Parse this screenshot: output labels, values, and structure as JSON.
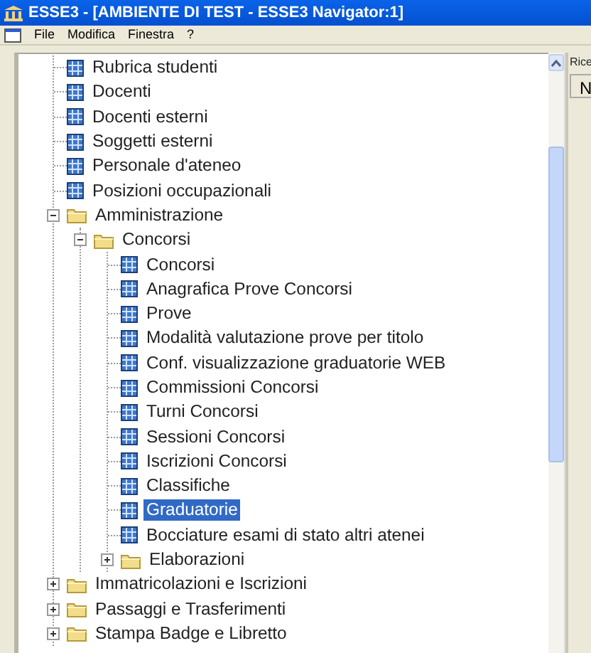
{
  "window": {
    "title": "ESSE3 - [AMBIENTE DI TEST - ESSE3  Navigator:1]"
  },
  "menu": [
    "File",
    "Modifica",
    "Finestra",
    "?"
  ],
  "tree": [
    {
      "kind": "leaf",
      "label": "Rubrica studenti",
      "selected": false
    },
    {
      "kind": "leaf",
      "label": "Docenti",
      "selected": false
    },
    {
      "kind": "leaf",
      "label": "Docenti esterni",
      "selected": false
    },
    {
      "kind": "leaf",
      "label": "Soggetti esterni",
      "selected": false
    },
    {
      "kind": "leaf",
      "label": "Personale d'ateneo",
      "selected": false
    },
    {
      "kind": "leaf",
      "label": "Posizioni occupazionali",
      "selected": false
    },
    {
      "kind": "folder",
      "label": "Amministrazione",
      "selected": false,
      "expanded": true,
      "children": [
        {
          "kind": "folder",
          "label": "Concorsi",
          "selected": false,
          "expanded": true,
          "children": [
            {
              "kind": "leaf",
              "label": "Concorsi",
              "selected": false
            },
            {
              "kind": "leaf",
              "label": "Anagrafica Prove Concorsi",
              "selected": false
            },
            {
              "kind": "leaf",
              "label": "Prove",
              "selected": false
            },
            {
              "kind": "leaf",
              "label": "Modalità valutazione prove per titolo",
              "selected": false
            },
            {
              "kind": "leaf",
              "label": "Conf. visualizzazione graduatorie WEB",
              "selected": false
            },
            {
              "kind": "leaf",
              "label": "Commissioni Concorsi",
              "selected": false
            },
            {
              "kind": "leaf",
              "label": "Turni Concorsi",
              "selected": false
            },
            {
              "kind": "leaf",
              "label": "Sessioni Concorsi",
              "selected": false
            },
            {
              "kind": "leaf",
              "label": "Iscrizioni Concorsi",
              "selected": false
            },
            {
              "kind": "leaf",
              "label": "Classifiche",
              "selected": false
            },
            {
              "kind": "leaf",
              "label": "Graduatorie",
              "selected": true
            },
            {
              "kind": "leaf",
              "label": "Bocciature esami di stato altri atenei",
              "selected": false
            },
            {
              "kind": "folder",
              "label": "Elaborazioni",
              "selected": false,
              "expanded": false
            }
          ]
        }
      ]
    },
    {
      "kind": "folder",
      "label": "Immatricolazioni e Iscrizioni",
      "selected": false,
      "expanded": false
    },
    {
      "kind": "folder",
      "label": "Passaggi e Trasferimenti",
      "selected": false,
      "expanded": false
    },
    {
      "kind": "folder",
      "label": "Stampa Badge e Libretto",
      "selected": false,
      "expanded": false
    }
  ],
  "side_panel": {
    "label": "Rice",
    "button": "N"
  }
}
